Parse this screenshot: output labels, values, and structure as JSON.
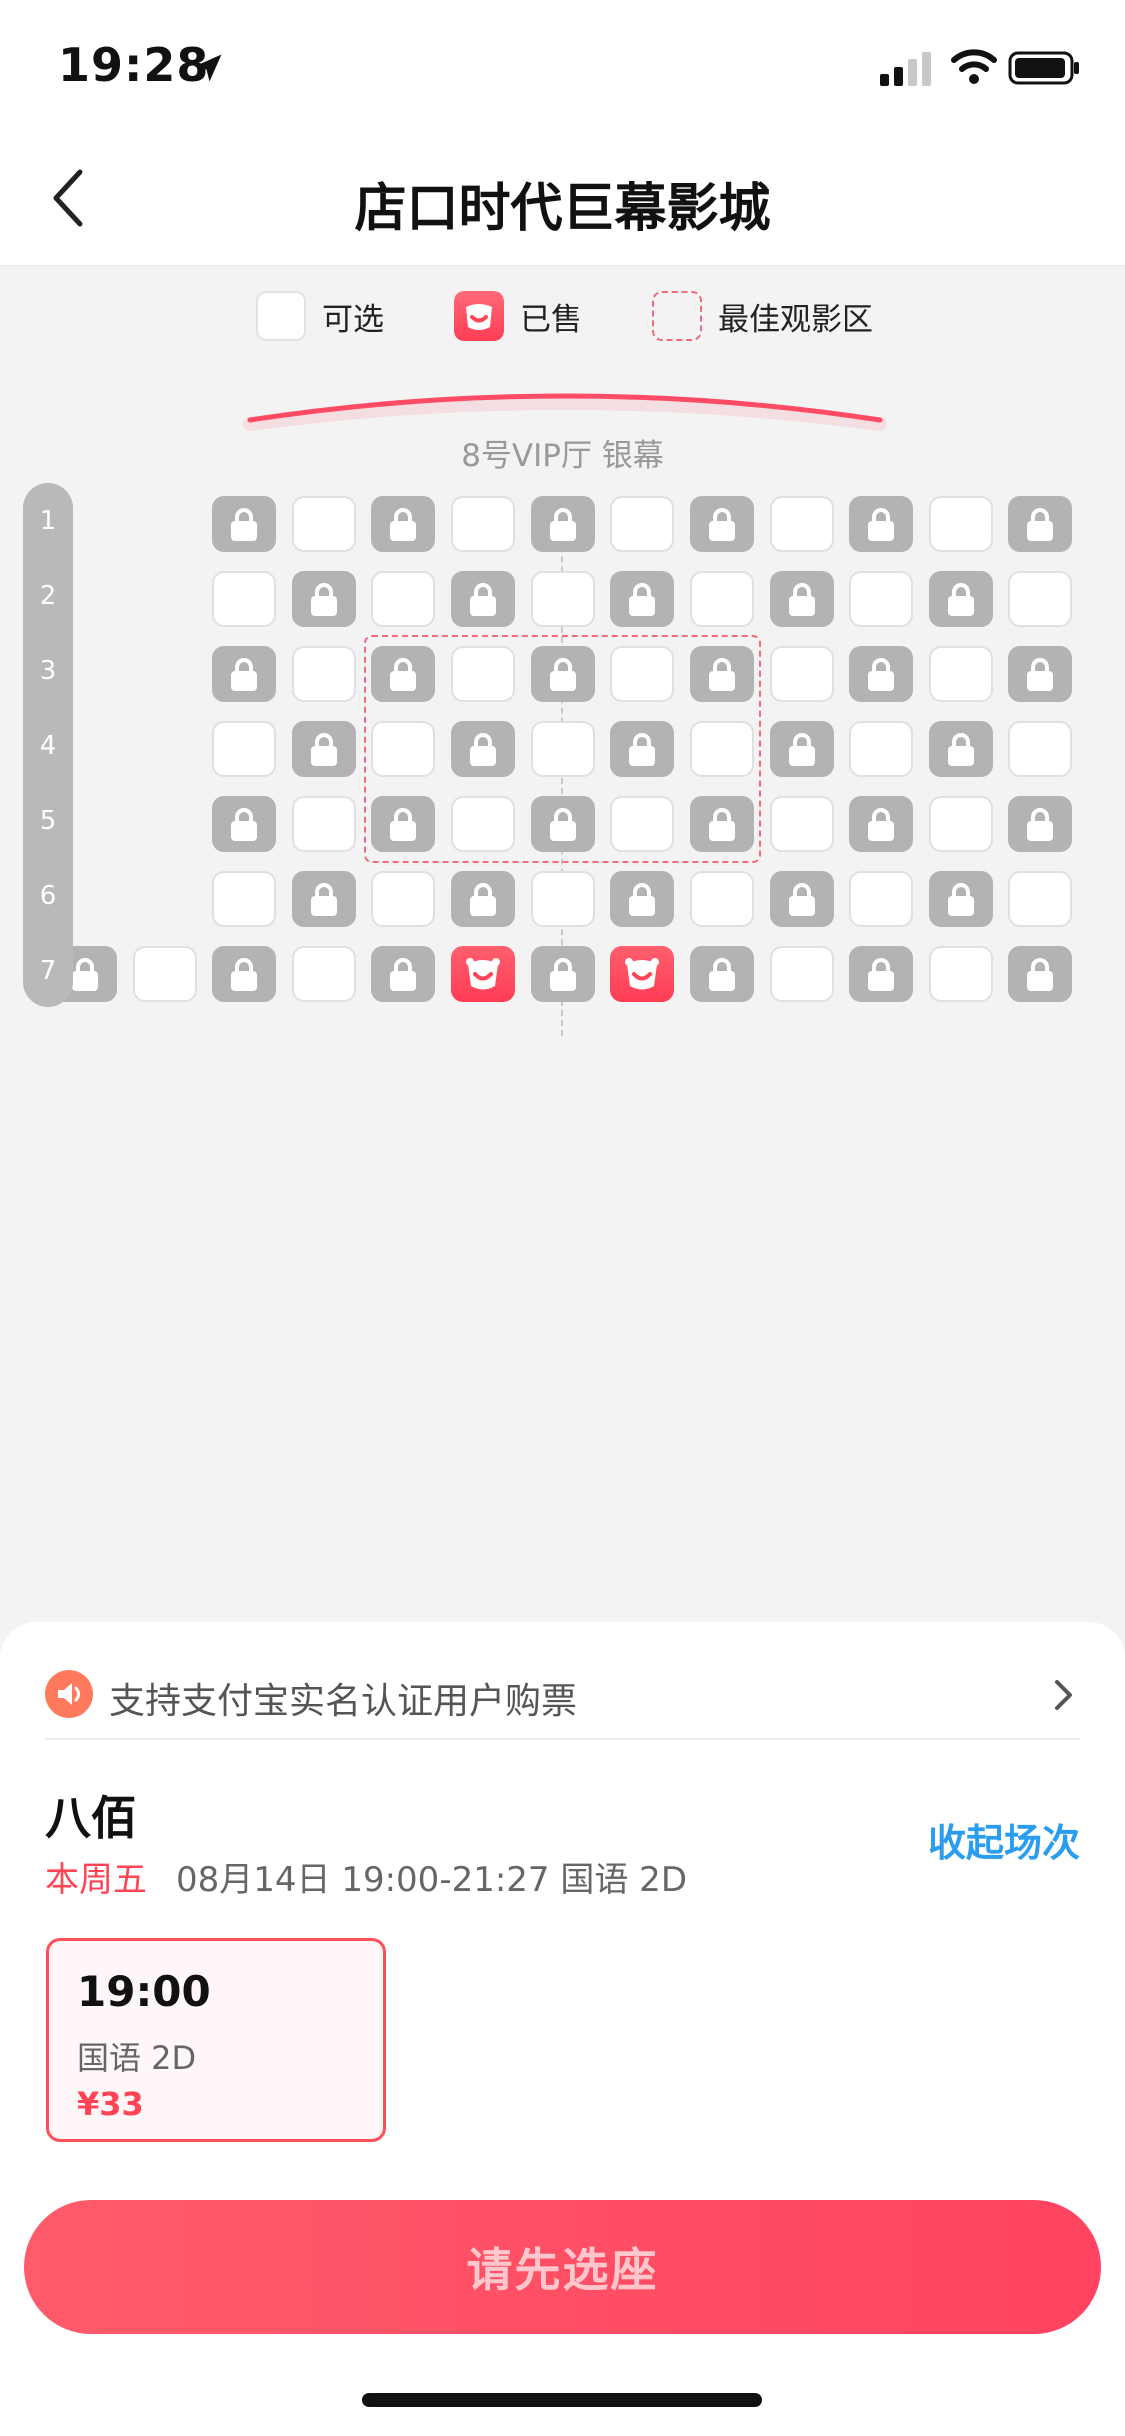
{
  "status": {
    "time": "19:28"
  },
  "nav": {
    "title": "店口时代巨幕影城"
  },
  "legend": {
    "available": "可选",
    "sold": "已售",
    "best": "最佳观影区"
  },
  "screen": {
    "label": "8号VIP厅 银幕"
  },
  "seatmap": {
    "rows": [
      "1",
      "2",
      "3",
      "4",
      "5",
      "6",
      "7"
    ],
    "layout": [
      "__LALALALALAL",
      "__ALALALALALA",
      "__LALALALALAL",
      "__ALALALALALA",
      "__LALALALALAL",
      "__ALALALALALA",
      "LALALSLSLALAL"
    ],
    "legend_codes": {
      "A": "available",
      "L": "locked",
      "S": "sold",
      "_": "none"
    }
  },
  "notice": {
    "text": "支持支付宝实名认证用户购票"
  },
  "movie": {
    "title": "八佰",
    "day": "本周五",
    "detail": "08月14日 19:00-21:27 国语 2D",
    "collapse_label": "收起场次"
  },
  "session": {
    "time": "19:00",
    "lang": "国语 2D",
    "price": "¥33"
  },
  "cta": {
    "label": "请先选座"
  },
  "colors": {
    "accent": "#ff4455",
    "link": "#2a9df0",
    "locked": "#b3b3b3"
  }
}
